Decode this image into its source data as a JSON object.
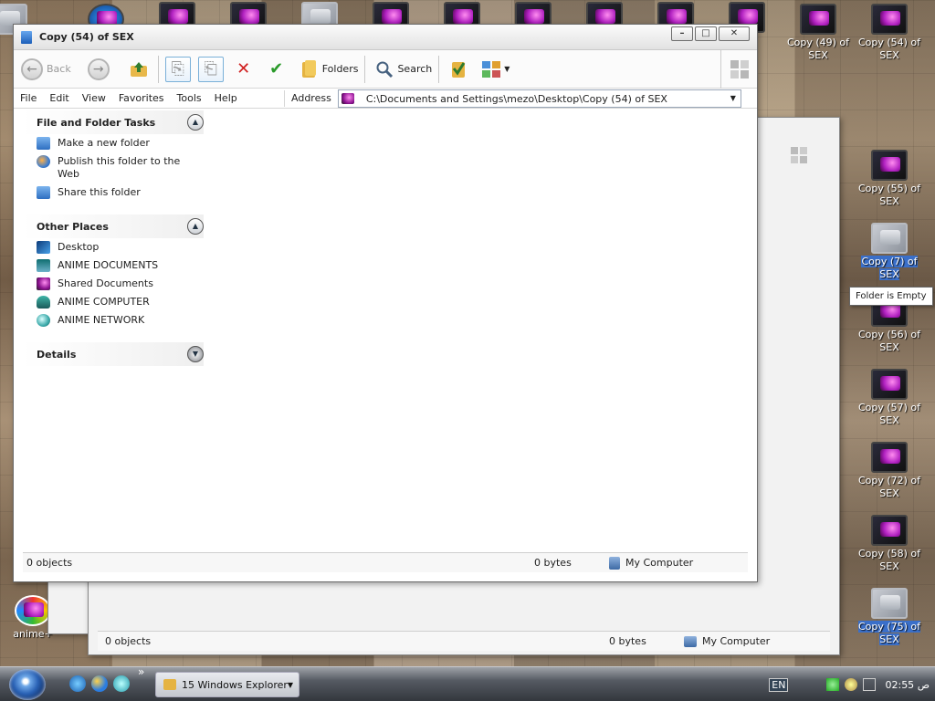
{
  "window": {
    "title": "Copy (54) of SEX",
    "controls": {
      "minimize": "–",
      "maximize": "□",
      "close": "✕"
    }
  },
  "toolbar": {
    "back": "Back",
    "folders": "Folders",
    "search": "Search"
  },
  "menu": {
    "file": "File",
    "edit": "Edit",
    "view": "View",
    "favorites": "Favorites",
    "tools": "Tools",
    "help": "Help"
  },
  "address": {
    "label": "Address",
    "path": "C:\\Documents and Settings\\mezo\\Desktop\\Copy (54) of SEX"
  },
  "tasks": {
    "file_folder": {
      "title": "File and Folder Tasks",
      "items": [
        "Make a new folder",
        "Publish this folder to the Web",
        "Share this folder"
      ]
    },
    "other_places": {
      "title": "Other Places",
      "items": [
        "Desktop",
        "ANIME DOCUMENTS",
        "Shared Documents",
        "ANIME COMPUTER",
        "ANIME NETWORK"
      ]
    },
    "details": {
      "title": "Details"
    }
  },
  "status": {
    "objects": "0 objects",
    "size": "0 bytes",
    "location": "My Computer"
  },
  "back_window_status": {
    "objects": "0 objects",
    "size": "0 bytes",
    "location": "My Computer"
  },
  "desktop": {
    "icons": [
      {
        "label": "Copy (49) of SEX"
      },
      {
        "label": "Copy (54) of SEX"
      },
      {
        "label": "Copy (55) of SEX"
      },
      {
        "label": "Copy (7) of SEX"
      },
      {
        "label": "Copy (56) of SEX"
      },
      {
        "label": "Copy (57) of SEX"
      },
      {
        "label": "Copy (72) of SEX"
      },
      {
        "label": "Copy (58) of SEX"
      },
      {
        "label": "Copy (75) of SEX"
      }
    ],
    "left_icon": "anime+",
    "tooltip": "Folder is Empty"
  },
  "taskbar": {
    "group_button": "15 Windows Explorer",
    "language": "EN",
    "clock": "02:55 ص"
  }
}
